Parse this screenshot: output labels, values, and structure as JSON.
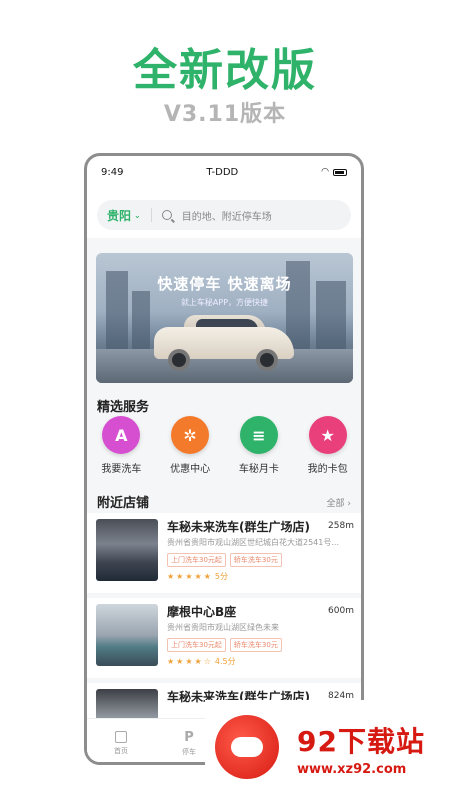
{
  "promo": {
    "title": "全新改版",
    "subtitle": "V3.11版本"
  },
  "statusbar": {
    "time": "9:49",
    "carrier": "T-DDD"
  },
  "header": {
    "city": "贵阳",
    "search_placeholder": "目的地、附近停车场"
  },
  "banner": {
    "title": "快速停车 快速离场",
    "subtitle": "就上车秘APP，方便快捷"
  },
  "services": {
    "title": "精选服务",
    "items": [
      {
        "label": "我要洗车",
        "icon": "car-wash-icon",
        "color": "#d64fd0"
      },
      {
        "label": "优惠中心",
        "icon": "discount-icon",
        "color": "#f47a2b"
      },
      {
        "label": "车秘月卡",
        "icon": "monthly-card-icon",
        "color": "#2fb36b"
      },
      {
        "label": "我的卡包",
        "icon": "card-wallet-icon",
        "color": "#e93f7a"
      }
    ]
  },
  "nearby": {
    "title": "附近店铺",
    "more_label": "全部",
    "stores": [
      {
        "name": "车秘未来洗车(群生广场店)",
        "distance": "258m",
        "address": "贵州省贵阳市观山湖区世纪城白花大道2541号...",
        "tags": [
          "上门洗车30元起",
          "轿车洗车30元"
        ],
        "stars": "★★★★★",
        "score": "5分"
      },
      {
        "name": "摩根中心B座",
        "distance": "600m",
        "address": "贵州省贵阳市观山湖区绿色未来",
        "tags": [
          "上门洗车30元起",
          "轿车洗车30元"
        ],
        "stars": "★★★★☆",
        "score": "4.5分"
      },
      {
        "name": "车秘未来洗车(群生广场店)",
        "distance": "824m",
        "address": "",
        "tags": [],
        "stars": "",
        "score": ""
      }
    ]
  },
  "tabbar": {
    "items": [
      {
        "label": "首页",
        "icon": "home-icon"
      },
      {
        "label": "停车",
        "icon": "parking-icon"
      }
    ]
  },
  "watermark": {
    "name": "92下载站",
    "url": "www.xz92.com"
  }
}
